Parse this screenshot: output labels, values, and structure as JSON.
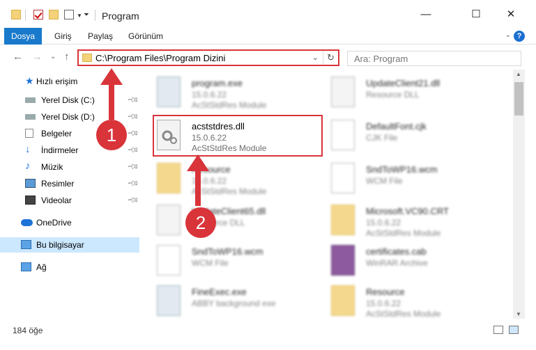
{
  "window": {
    "title": "Program",
    "minimize": "—",
    "maximize": "☐",
    "close": "✕"
  },
  "ribbon": {
    "tabs": [
      "Dosya",
      "Giriş",
      "Paylaş",
      "Görünüm"
    ],
    "help": "?"
  },
  "address": {
    "path": "C:\\Program Files\\Program Dizini",
    "search_placeholder": "Ara: Program"
  },
  "sidebar": {
    "items": [
      {
        "label": "Hızlı erişim",
        "icon": "star-icon"
      },
      {
        "label": "Yerel Disk (C:)",
        "icon": "drive-icon"
      },
      {
        "label": "Yerel Disk (D:)",
        "icon": "drive-icon"
      },
      {
        "label": "Belgeler",
        "icon": "documents-icon"
      },
      {
        "label": "İndirmeler",
        "icon": "download-icon"
      },
      {
        "label": "Müzik",
        "icon": "music-icon"
      },
      {
        "label": "Resimler",
        "icon": "pictures-icon"
      },
      {
        "label": "Videolar",
        "icon": "videos-icon"
      },
      {
        "label": "OneDrive",
        "icon": "cloud-icon"
      },
      {
        "label": "Bu bilgisayar",
        "icon": "computer-icon"
      },
      {
        "label": "Ağ",
        "icon": "network-icon"
      }
    ]
  },
  "files": [
    {
      "name": "program.exe",
      "line1": "15.0.6.22",
      "line2": "AcStStdRes Module",
      "icon": "exe-icon"
    },
    {
      "name": "UpdateClient21.dll",
      "line1": "Resource DLL",
      "line2": "",
      "icon": "dll-icon"
    },
    {
      "name": "acststdres.dll",
      "line1": "15.0.6.22",
      "line2": "AcStStdRes Module",
      "icon": "dll-gear-icon"
    },
    {
      "name": "DefaultFont.cjk",
      "line1": "CJK File",
      "line2": "",
      "icon": "document-icon"
    },
    {
      "name": "Resource",
      "line1": "15.0.6.22",
      "line2": "AcStStdRes Module",
      "icon": "folder-icon"
    },
    {
      "name": "SndToWP16.wcm",
      "line1": "WCM File",
      "line2": "",
      "icon": "document-icon"
    },
    {
      "name": "UpdateClient65.dll",
      "line1": "Resource DLL",
      "line2": "",
      "icon": "dll-icon"
    },
    {
      "name": "Microsoft.VC90.CRT",
      "line1": "15.0.6.22",
      "line2": "AcStStdRes Module",
      "icon": "folder-icon"
    },
    {
      "name": "SndToWP16.wcm",
      "line1": "WCM File",
      "line2": "",
      "icon": "document-icon"
    },
    {
      "name": "certificates.cab",
      "line1": "WinRAR Archive",
      "line2": "",
      "icon": "archive-icon"
    },
    {
      "name": "FineExec.exe",
      "line1": "ABBY background exe",
      "line2": "",
      "icon": "exe-icon"
    },
    {
      "name": "Resource",
      "line1": "15.0.6.22",
      "line2": "AcStStdRes Module",
      "icon": "folder-icon"
    }
  ],
  "annotations": {
    "step1": "1",
    "step2": "2"
  },
  "status": {
    "count": "184 öğe"
  },
  "colors": {
    "accent": "#1979ca",
    "highlight": "#d9343a",
    "selected": "#cce8ff"
  }
}
